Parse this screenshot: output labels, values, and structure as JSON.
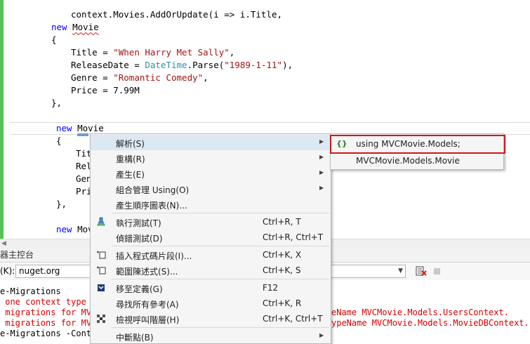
{
  "code": {
    "line1": "context.Movies.AddOrUpdate(i => i.Title,",
    "kw_new": "new",
    "movie": "Movie",
    "open_brace": "{",
    "title_prop": "Title = ",
    "title_val": "\"When Harry Met Sally\"",
    "comma": ",",
    "release_prop": "ReleaseDate = ",
    "datetime": "DateTime",
    "parse": ".Parse(",
    "release_val": "\"1989-1-11\"",
    "release_end": "),",
    "genre_prop": "Genre = ",
    "genre_val": "\"Romantic Comedy\"",
    "price_line": "Price = 7.99M",
    "close_brace": "},",
    "partial_tit": "Tit",
    "partial_rel": "Rel",
    "partial_gen": "Gen",
    "partial_pri": "Pri",
    "partial_mov": "Mov"
  },
  "console": {
    "title": "器主控台",
    "source_label": "(K):",
    "source_value": "nuget.org",
    "lines": [
      "e-Migrations",
      " one context type was",
      " migrations for MVCMo",
      " migrations for MVCMo",
      "e-Migrations -Context"
    ],
    "right_line1": "eName MVCMovie.Models.UsersContext.",
    "right_line2": "ypeName MVCMovie.Models.MovieDBContext."
  },
  "context_menu": {
    "items": [
      {
        "label": "解析(S)",
        "shortcut": "",
        "has_sub": true
      },
      {
        "label": "重構(R)",
        "shortcut": "",
        "has_sub": true
      },
      {
        "label": "產生(E)",
        "shortcut": "",
        "has_sub": true
      },
      {
        "label": "組合管理 Using(O)",
        "shortcut": "",
        "has_sub": true
      },
      {
        "label": "產生順序圖表(N)...",
        "shortcut": "",
        "has_sub": false
      },
      {
        "label": "執行測試(T)",
        "shortcut": "Ctrl+R, T",
        "has_sub": false
      },
      {
        "label": "偵錯測試(D)",
        "shortcut": "Ctrl+R, Ctrl+T",
        "has_sub": false
      },
      {
        "label": "插入程式碼片段(I)...",
        "shortcut": "Ctrl+K, X",
        "has_sub": false
      },
      {
        "label": "範圍陳述式(S)...",
        "shortcut": "Ctrl+K, S",
        "has_sub": false
      },
      {
        "label": "移至定義(G)",
        "shortcut": "F12",
        "has_sub": false
      },
      {
        "label": "尋找所有參考(A)",
        "shortcut": "Ctrl+K, R",
        "has_sub": false
      },
      {
        "label": "檢視呼叫階層(H)",
        "shortcut": "Ctrl+K, Ctrl+T",
        "has_sub": false
      },
      {
        "label": "中斷點(B)",
        "shortcut": "",
        "has_sub": true
      }
    ]
  },
  "submenu": {
    "items": [
      {
        "label": "using MVCMovie.Models;"
      },
      {
        "label": "MVCMovie.Models.Movie"
      }
    ]
  },
  "colors": {
    "keyword": "#0000ff",
    "string": "#a31515",
    "type": "#2b91af",
    "highlight_box": "#d01818"
  }
}
